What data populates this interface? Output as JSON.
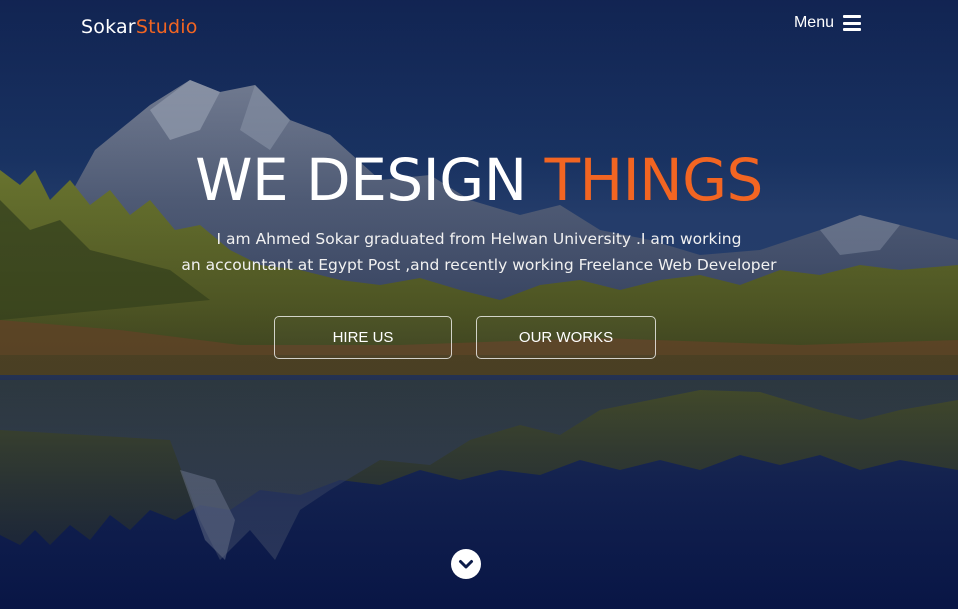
{
  "navbar": {
    "brand_primary": "Sokar",
    "brand_accent": "Studio",
    "menu_label": "Menu",
    "menu_icon": "hamburger-icon"
  },
  "hero": {
    "headline_primary": "WE DESIGN",
    "headline_accent": "THINGS",
    "description_line1": "I am Ahmed Sokar graduated from Helwan University .I am working",
    "description_line2": "an accountant at Egypt Post ,and recently working Freelance Web Developer",
    "background_image": "mountain-lake-landscape"
  },
  "buttons": {
    "hire_label": "HIRE US",
    "works_label": "OUR WORKS"
  },
  "scroll": {
    "icon": "chevron-down-icon"
  },
  "colors": {
    "accent": "#f26522",
    "text": "#ffffff",
    "overlay": "#0d1c4a"
  }
}
